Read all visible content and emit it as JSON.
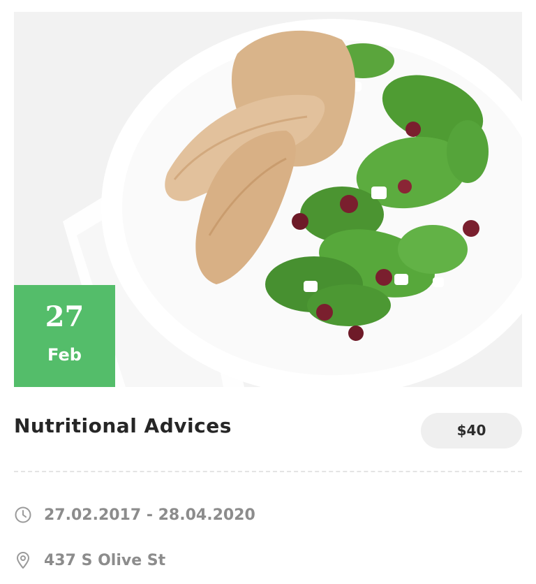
{
  "event": {
    "image_alt": "Grilled chicken with spinach salad",
    "date_badge": {
      "day": "27",
      "month": "Feb"
    },
    "title": "Nutritional Advices",
    "price": "$40",
    "date_range": "27.02.2017 - 28.04.2020",
    "location": "437 S Olive St"
  },
  "icons": {
    "clock": "clock-icon",
    "location": "map-pin-icon"
  },
  "colors": {
    "badge_green": "#54bd6a",
    "price_bg": "#efefef",
    "meta_text": "#8c8c8c",
    "title_text": "#262626"
  }
}
